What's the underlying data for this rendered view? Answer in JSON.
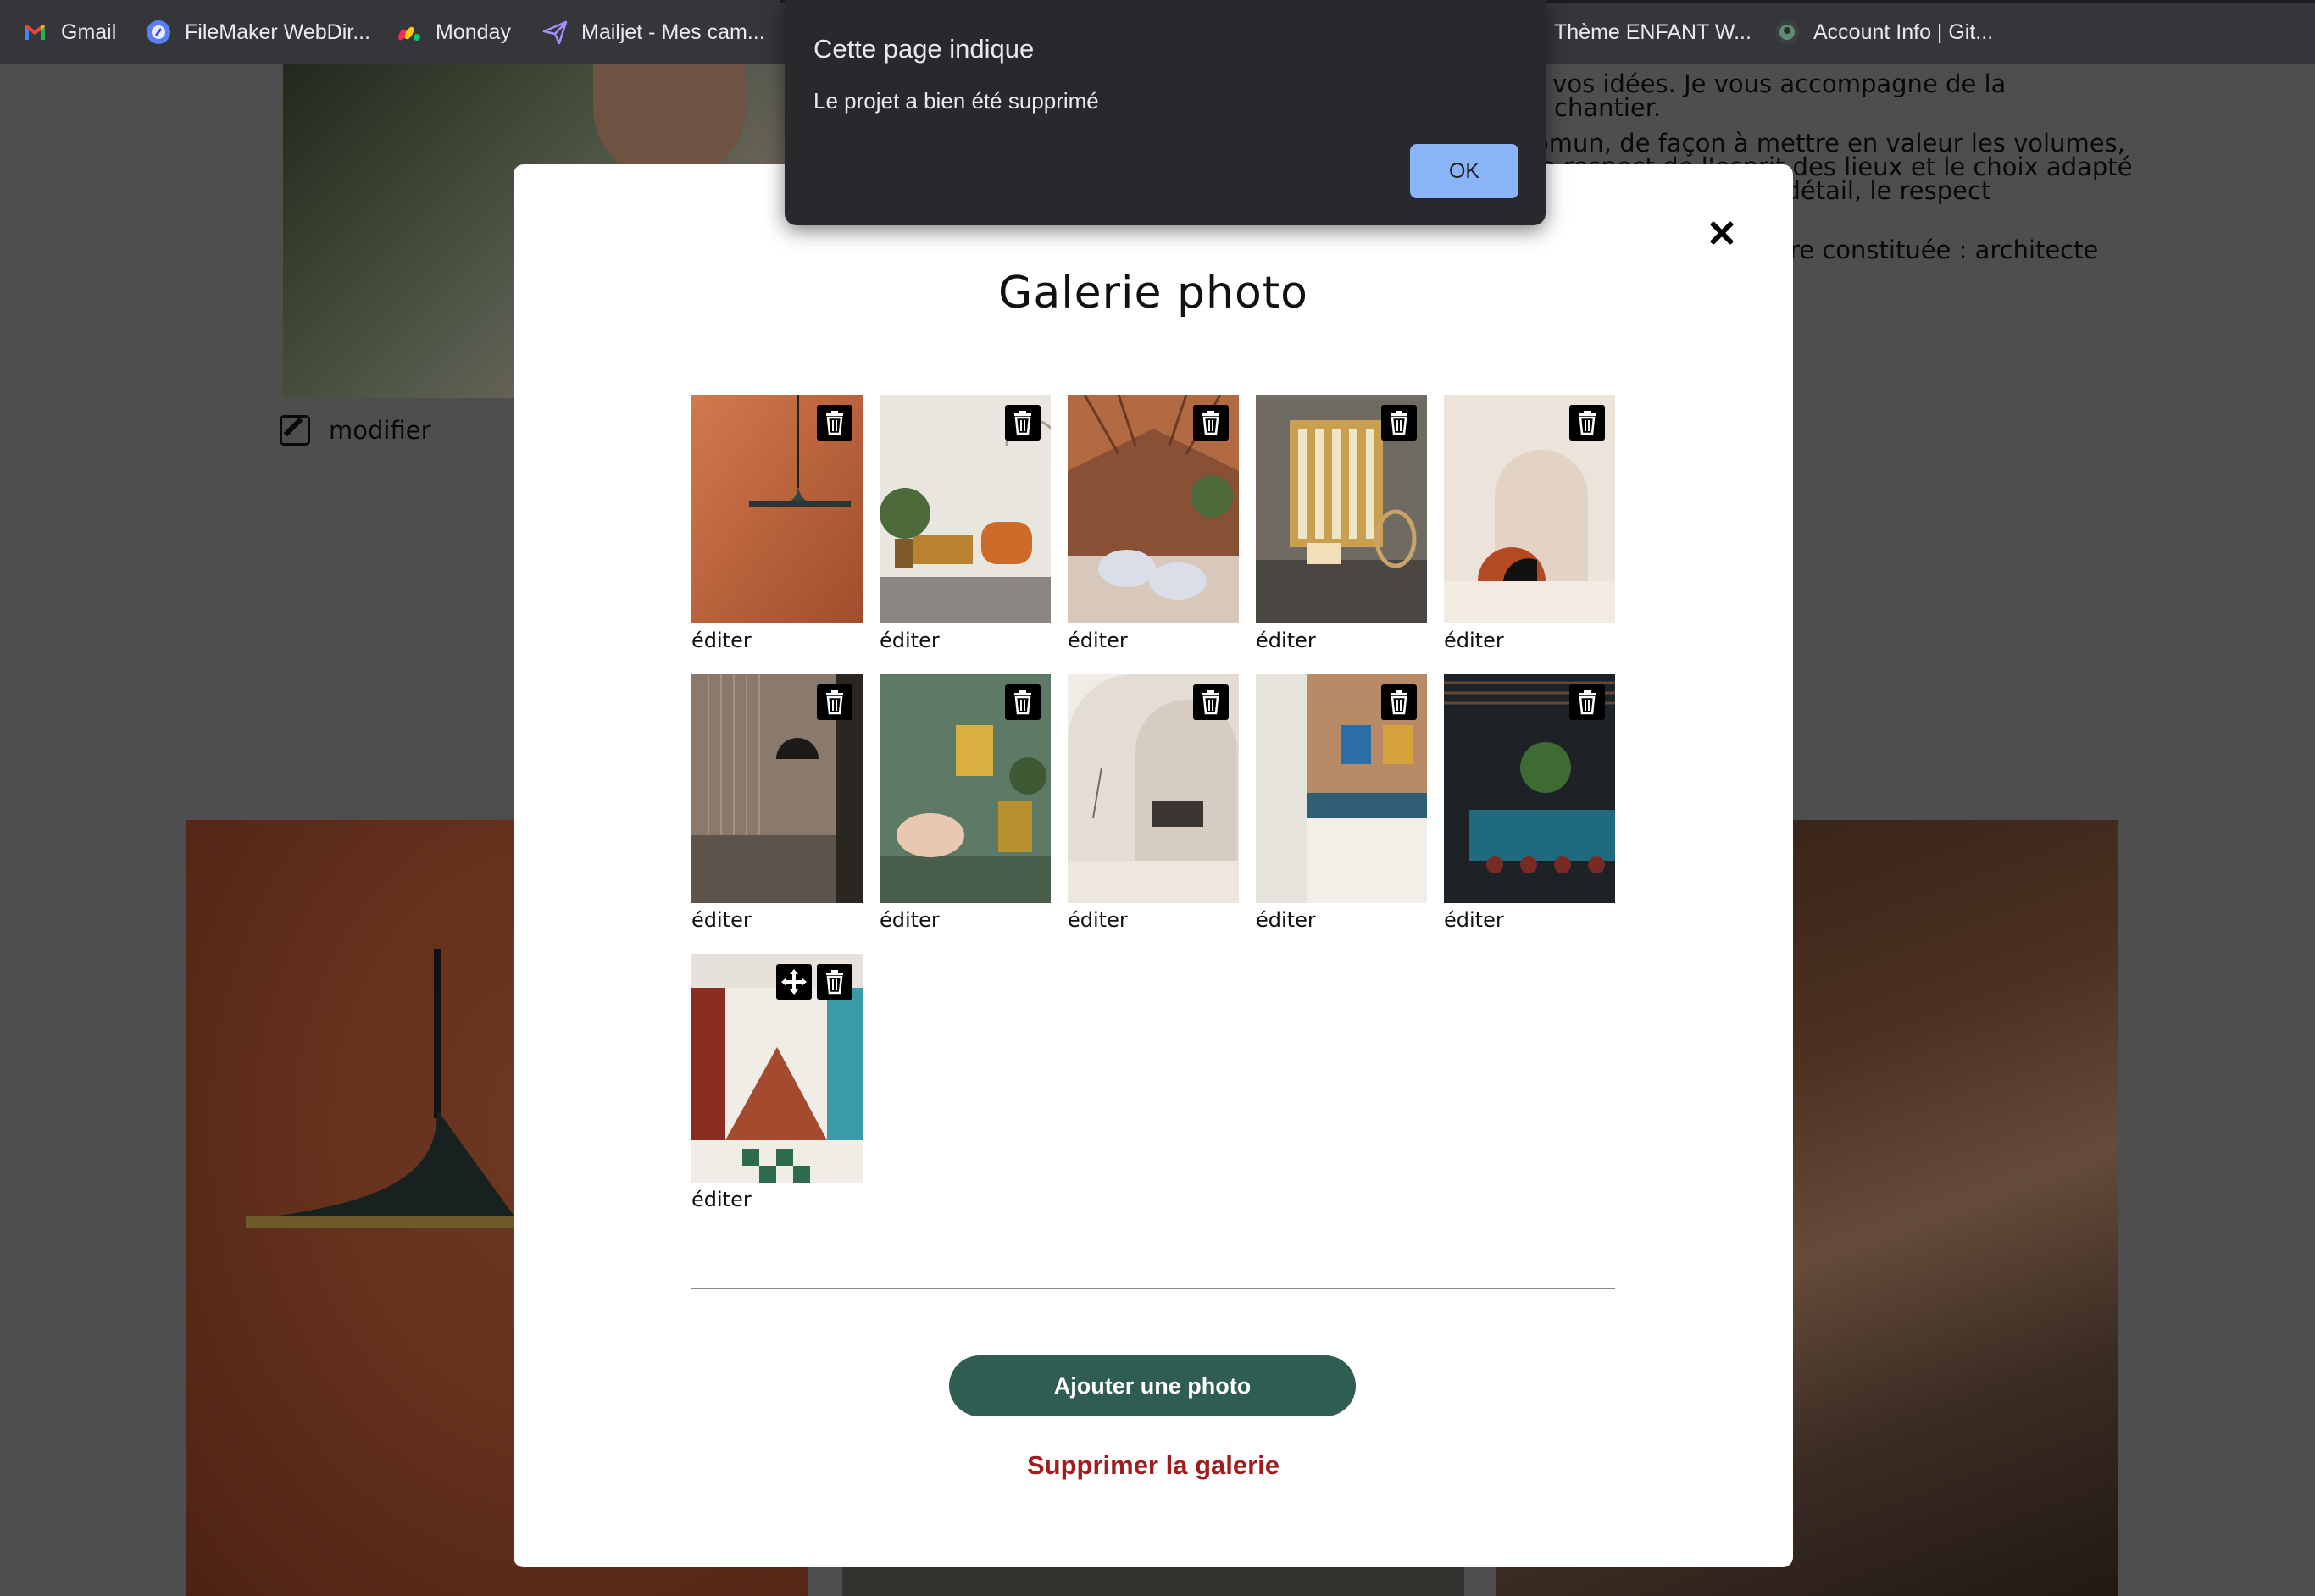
{
  "bookmarks": [
    {
      "label": "Gmail",
      "icon": "gmail-icon"
    },
    {
      "label": "FileMaker WebDir...",
      "icon": "filemaker-icon"
    },
    {
      "label": "Monday",
      "icon": "monday-icon"
    },
    {
      "label": "Mailjet - Mes cam...",
      "icon": "mailjet-icon"
    },
    {
      "label": "Thème ENFANT W...",
      "icon": "blank"
    },
    {
      "label": "Account Info | Git...",
      "icon": "github-icon"
    }
  ],
  "background_page": {
    "text_lines": [
      "se vos idées. Je vous accompagne de la",
      "chantier.",
      "omun, de façon à mettre en valeur les volumes,",
      "le respect de l'esprit des lieux et le choix adapté",
      "souci du détail, le respect",
      "re constituée : architecte"
    ],
    "modify_label": "modifier"
  },
  "alert": {
    "title": "Cette page indique",
    "message": "Le projet a bien été supprimé",
    "ok_label": "OK"
  },
  "modal": {
    "title": "Galerie photo",
    "edit_label": "éditer",
    "add_photo_label": "Ajouter une photo",
    "delete_gallery_label": "Supprimer la galerie",
    "photos": [
      {
        "subject": "pendant lamp on terracotta wall"
      },
      {
        "subject": "living room with orange armchair"
      },
      {
        "subject": "restaurant with wooden slat ceiling"
      },
      {
        "subject": "room with hanging rattan chair"
      },
      {
        "subject": "arched wall shapes"
      },
      {
        "subject": "kitchen with wall light"
      },
      {
        "subject": "green room with armchair"
      },
      {
        "subject": "white arched corridor"
      },
      {
        "subject": "bedroom with portraits"
      },
      {
        "subject": "bar with blue counter"
      },
      {
        "subject": "dining hall with checkered floor"
      }
    ]
  },
  "colors": {
    "add_button": "#2f5d52",
    "delete_gallery": "#a11d1d",
    "alert_ok": "#8ab4f8"
  }
}
